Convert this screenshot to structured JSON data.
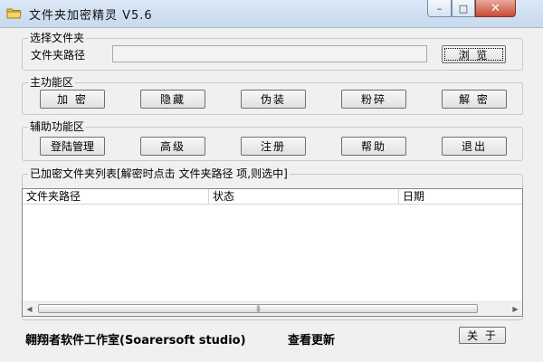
{
  "window": {
    "title": "文件夹加密精灵 V5.6",
    "controls": {
      "minimize": "–",
      "maximize": "□",
      "close": "✕"
    }
  },
  "folder_select": {
    "group_label": "选择文件夹",
    "path_label": "文件夹路径",
    "path_value": "",
    "browse_button": "浏 览"
  },
  "main_functions": {
    "group_label": "主功能区",
    "buttons": [
      "加 密",
      "隐藏",
      "伪装",
      "粉碎",
      "解 密"
    ]
  },
  "aux_functions": {
    "group_label": "辅助功能区",
    "buttons": [
      "登陆管理",
      "高级",
      "注册",
      "帮助",
      "退出"
    ]
  },
  "encrypted_list": {
    "group_label": "已加密文件夹列表[解密时点击 文件夹路径 项,则选中]",
    "columns": [
      "文件夹路径",
      "状态",
      "日期"
    ],
    "rows": [],
    "scroll_left": "◀",
    "scroll_right": "▶",
    "scroll_grip": "|||"
  },
  "footer": {
    "studio": "翱翔者软件工作室(Soarersoft studio)",
    "update_link": "查看更新",
    "about_button": "关 于"
  }
}
